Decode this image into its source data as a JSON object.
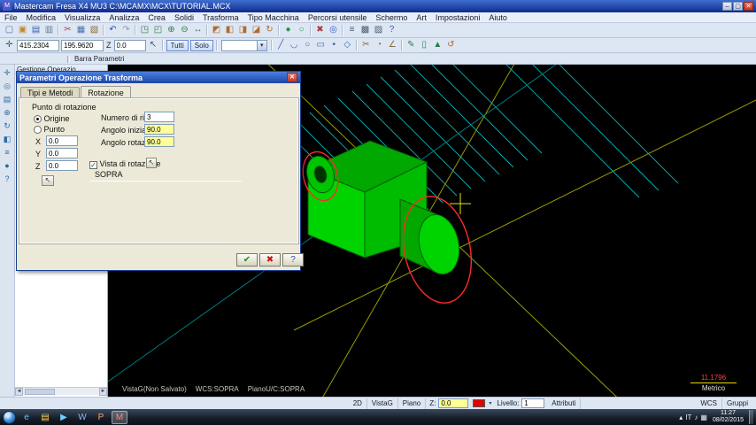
{
  "window": {
    "title": "Mastercam Fresa X4 MU3   C:\\MCAMX\\MCX\\TUTORIAL.MCX",
    "app_initial": "M",
    "buttons": {
      "minimize": "–",
      "maximize": "▢",
      "close": "✕"
    }
  },
  "menu": {
    "items": [
      "File",
      "Modifica",
      "Visualizza",
      "Analizza",
      "Crea",
      "Solidi",
      "Trasforma",
      "Tipo Macchina",
      "Percorsi utensile",
      "Schermo",
      "Art",
      "Impostazioni",
      "Aiuto"
    ]
  },
  "toolbar_top": {
    "icons": [
      {
        "name": "new-file-icon",
        "g": "▢",
        "c": "#4a6fae"
      },
      {
        "name": "open-folder-icon",
        "g": "▣",
        "c": "#c08a2e"
      },
      {
        "name": "save-icon",
        "g": "▤",
        "c": "#3a62b5"
      },
      {
        "name": "print-icon",
        "g": "▥",
        "c": "#62798f"
      },
      {
        "name": "toolbar-separator",
        "g": "",
        "int": false
      },
      {
        "name": "cut-icon",
        "g": "✂",
        "c": "#a04848"
      },
      {
        "name": "copy-icon",
        "g": "▦",
        "c": "#4a6fae"
      },
      {
        "name": "paste-icon",
        "g": "▧",
        "c": "#8a6a3a"
      },
      {
        "name": "toolbar-separator",
        "g": "",
        "int": false
      },
      {
        "name": "undo-icon",
        "g": "↶",
        "c": "#2a52a5"
      },
      {
        "name": "redo-icon",
        "g": "↷",
        "c": "#8a9ab0"
      },
      {
        "name": "toolbar-separator",
        "g": "",
        "int": false
      },
      {
        "name": "zoom-fit-icon",
        "g": "◳",
        "c": "#2e7d46"
      },
      {
        "name": "zoom-window-icon",
        "g": "◰",
        "c": "#2e7d46"
      },
      {
        "name": "zoom-in-icon",
        "g": "⊕",
        "c": "#2e7d46"
      },
      {
        "name": "zoom-out-icon",
        "g": "⊖",
        "c": "#2e7d46"
      },
      {
        "name": "pan-icon",
        "g": "↔",
        "c": "#2e7d46"
      },
      {
        "name": "toolbar-separator",
        "g": "",
        "int": false
      },
      {
        "name": "gview-isometric-icon",
        "g": "◩",
        "c": "#b06a30"
      },
      {
        "name": "gview-top-icon",
        "g": "◧",
        "c": "#b06a30"
      },
      {
        "name": "gview-front-icon",
        "g": "◨",
        "c": "#b06a30"
      },
      {
        "name": "gview-side-icon",
        "g": "◪",
        "c": "#b06a30"
      },
      {
        "name": "rotate-view-icon",
        "g": "↻",
        "c": "#b06a30"
      },
      {
        "name": "toolbar-separator",
        "g": "",
        "int": false
      },
      {
        "name": "shading-icon",
        "g": "●",
        "c": "#2e9050"
      },
      {
        "name": "wireframe-icon",
        "g": "○",
        "c": "#2e9050"
      },
      {
        "name": "toolbar-separator",
        "g": "",
        "int": false
      },
      {
        "name": "delete-icon",
        "g": "✖",
        "c": "#b03a3a"
      },
      {
        "name": "analyze-icon",
        "g": "◎",
        "c": "#3a62b5"
      },
      {
        "name": "toolbar-separator",
        "g": "",
        "int": false
      },
      {
        "name": "levels-icon",
        "g": "≡",
        "c": "#4a5a70"
      },
      {
        "name": "grid-icon",
        "g": "▩",
        "c": "#4a5a70"
      },
      {
        "name": "attributes-icon",
        "g": "▨",
        "c": "#4a5a70"
      },
      {
        "name": "help-icon",
        "g": "?",
        "c": "#3a62b5"
      }
    ]
  },
  "toolbar_second": {
    "autocursor_glyph": "✛",
    "x_value": "415.2304",
    "y_value": "195.9620",
    "z_label": "Z",
    "z_value": "0.0",
    "select_glyph": "↖",
    "buttons": {
      "tutti": "Tutti",
      "solo": "Solo"
    },
    "combo_arrow": "▾",
    "icons_right": [
      {
        "name": "line-icon",
        "g": "╱",
        "c": "#3a62b5"
      },
      {
        "name": "arc-icon",
        "g": "◡",
        "c": "#3a62b5"
      },
      {
        "name": "circle-icon",
        "g": "○",
        "c": "#3a62b5"
      },
      {
        "name": "rectangle-icon",
        "g": "▭",
        "c": "#3a62b5"
      },
      {
        "name": "point-icon",
        "g": "•",
        "c": "#3a62b5"
      },
      {
        "name": "polygon-icon",
        "g": "◇",
        "c": "#3a62b5"
      },
      {
        "name": "toolbar-separator",
        "g": "",
        "int": false
      },
      {
        "name": "trim-icon",
        "g": "✂",
        "c": "#8a6a3a"
      },
      {
        "name": "fillet-icon",
        "g": "◔",
        "c": "#8a6a3a"
      },
      {
        "name": "chamfer-icon",
        "g": "∠",
        "c": "#8a6a3a"
      },
      {
        "name": "toolbar-separator",
        "g": "",
        "int": false
      },
      {
        "name": "sketch-icon",
        "g": "✎",
        "c": "#2e7d46"
      },
      {
        "name": "surface-icon",
        "g": "▯",
        "c": "#2e7d46"
      },
      {
        "name": "solids-icon",
        "g": "▲",
        "c": "#2e7d46"
      },
      {
        "name": "transform-icon",
        "g": "↺",
        "c": "#b06a30"
      }
    ]
  },
  "param_bar": {
    "label": "Barra Parametri"
  },
  "left_toolbar": {
    "icons": [
      {
        "name": "mru-functions-icon",
        "g": "✛",
        "c": "#2a6aa0"
      },
      {
        "name": "analyze-point-icon",
        "g": "◎",
        "c": "#2a6aa0"
      },
      {
        "name": "file-strip-icon",
        "g": "▤",
        "c": "#2a6aa0"
      },
      {
        "name": "zoom-strip-icon",
        "g": "⊕",
        "c": "#2a6aa0"
      },
      {
        "name": "repaint-icon",
        "g": "↻",
        "c": "#2a6aa0"
      },
      {
        "name": "views-strip-icon",
        "g": "◧",
        "c": "#2a6aa0"
      },
      {
        "name": "levels-strip-icon",
        "g": "≡",
        "c": "#2a6aa0"
      },
      {
        "name": "shade-strip-icon",
        "g": "●",
        "c": "#2a6aa0"
      },
      {
        "name": "help-strip-icon",
        "g": "?",
        "c": "#2a6aa0"
      }
    ]
  },
  "ops_panel": {
    "title": "Gestione Operazio..."
  },
  "dialog": {
    "title": "Parametri Operazione Trasforma",
    "close_glyph": "✕",
    "tabs": {
      "methods": "Tipi e Metodi",
      "rotation": "Rotazione"
    },
    "group_label": "Punto di rotazione",
    "radio_origin": "Origine",
    "radio_point": "Punto",
    "x_label": "X",
    "x_value": "0.0",
    "y_label": "Y",
    "y_value": "0.0",
    "z_label": "Z",
    "z_value": "0.0",
    "select_point_glyph": "↖",
    "repeat_label": "Numero di ripetizioni",
    "repeat_value": "3",
    "angle_start_label": "Angolo iniziale",
    "angle_start_value": "90.0",
    "angle_rot_label": "Angolo rotazione",
    "angle_rot_value": "90.0",
    "check_glyph": "✓",
    "view_check_label": "Vista di rotazione",
    "select_view_glyph": "↖",
    "view_value": "SOPRA",
    "buttons": {
      "ok": "✔",
      "cancel": "✖",
      "help": "?"
    }
  },
  "viewport": {
    "gview": "VistaG(Non Salvato)",
    "wcs": "WCS:SOPRA",
    "cplane": "PianoU/C:SOPRA",
    "scale_value": "11.1796",
    "scale_units": "Metrico",
    "colors": {
      "model_green": "#00d400",
      "outline_red": "#ff2a2a",
      "toolpath_teal": "#00b7b7",
      "construction_olive": "#9a9a00"
    }
  },
  "statusbar": {
    "d2": "2D",
    "gview": "VistaG",
    "plane": "Piano",
    "z_label": "Z:",
    "z_value": "0.0",
    "color_hex": "#e00000",
    "dropdown_glyph": "▾",
    "level_label": "Livello:",
    "level_value": "1",
    "attributes": "Attributi",
    "wcs": "WCS",
    "groups": "Gruppi"
  },
  "taskbar": {
    "icons": [
      {
        "name": "taskbar-ie-icon",
        "g": "e",
        "c": "#5ac8ff"
      },
      {
        "name": "taskbar-explorer-icon",
        "g": "▤",
        "c": "#ffd24a"
      },
      {
        "name": "taskbar-media-icon",
        "g": "▶",
        "c": "#6ad0ff"
      },
      {
        "name": "taskbar-word-icon",
        "g": "W",
        "c": "#8ab4ff"
      },
      {
        "name": "taskbar-powerpoint-icon",
        "g": "P",
        "c": "#ffa06a"
      },
      {
        "name": "taskbar-mastercam-icon",
        "g": "M",
        "c": "#ff8a7a",
        "active": true
      }
    ],
    "tray": {
      "expand": "▴",
      "lang": "IT",
      "icons": [
        {
          "name": "tray-volume-icon",
          "g": "♪",
          "c": "#dfe8f2"
        },
        {
          "name": "tray-network-icon",
          "g": "▦",
          "c": "#dfe8f2"
        }
      ],
      "time": "11:27",
      "date": "08/02/2015"
    }
  }
}
